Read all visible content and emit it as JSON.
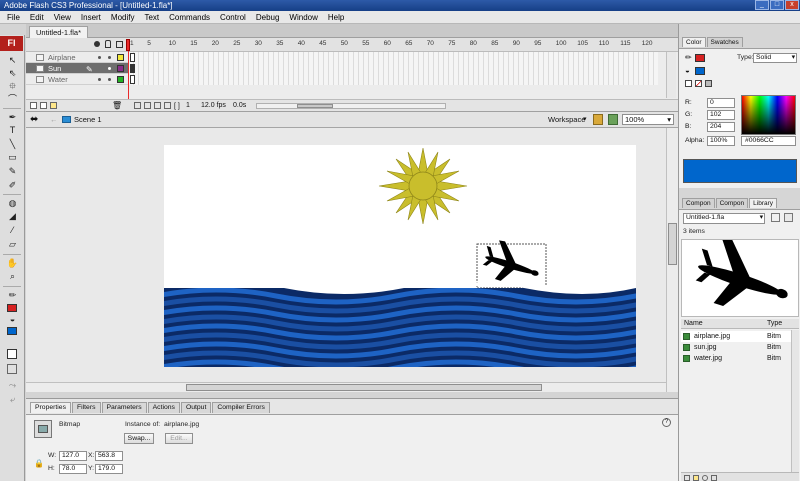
{
  "window": {
    "title": "Adobe Flash CS3 Professional - [Untitled-1.fla*]",
    "controls": [
      "_",
      "□",
      "x"
    ]
  },
  "menubar": [
    "File",
    "Edit",
    "View",
    "Insert",
    "Modify",
    "Text",
    "Commands",
    "Control",
    "Debug",
    "Window",
    "Help"
  ],
  "tools": {
    "logo": "Fl",
    "icons": [
      "selection-tool-icon",
      "subselection-tool-icon",
      "free-transform-tool-icon",
      "lasso-tool-icon",
      "pen-tool-icon",
      "text-tool-icon",
      "line-tool-icon",
      "rectangle-tool-icon",
      "pencil-tool-icon",
      "brush-tool-icon",
      "ink-bottle-icon",
      "paint-bucket-icon",
      "eyedropper-icon",
      "eraser-tool-icon",
      "hand-tool-icon",
      "zoom-tool-icon",
      "stroke-color-icon",
      "fill-color-icon"
    ]
  },
  "document": {
    "tab": "Untitled-1.fla*"
  },
  "timeline": {
    "ticks": [
      "1",
      "5",
      "10",
      "15",
      "20",
      "25",
      "30",
      "35",
      "40",
      "45",
      "50",
      "55",
      "60",
      "65",
      "70",
      "75",
      "80",
      "85",
      "90",
      "95",
      "100",
      "105",
      "110",
      "115",
      "120"
    ],
    "layers": [
      {
        "name": "Airplane",
        "color": "#f2e83a",
        "selected": false
      },
      {
        "name": "Sun",
        "color": "#8b2d8b",
        "selected": true
      },
      {
        "name": "Water",
        "color": "#22b422",
        "selected": false
      }
    ],
    "current_frame": "1",
    "fps": "12.0 fps",
    "time": "0.0s"
  },
  "editbar": {
    "scene": "Scene 1",
    "workspace": "Workspace",
    "zoom": "100%"
  },
  "stage": {
    "background": "#ffffff",
    "sun_color": "#c9be2c",
    "water_colors": [
      "#0b2a66",
      "#1e63c4"
    ],
    "airplane_color": "#000000"
  },
  "properties": {
    "tabs": [
      "Properties",
      "Filters",
      "Parameters",
      "Actions",
      "Output",
      "Compiler Errors"
    ],
    "type": "Bitmap",
    "instance_of_label": "Instance of:",
    "instance_of": "airplane.jpg",
    "swap": "Swap...",
    "edit": "Edit...",
    "w_label": "W:",
    "w": "127.0",
    "x_label": "X:",
    "x": "563.8",
    "h_label": "H:",
    "h": "78.0",
    "y_label": "Y:",
    "y": "179.0"
  },
  "color_panel": {
    "tabs": [
      "Color",
      "Swatches"
    ],
    "type_label": "Type:",
    "type": "Solid",
    "r_label": "R:",
    "r": "0",
    "g_label": "G:",
    "g": "102",
    "b_label": "B:",
    "b": "204",
    "alpha_label": "Alpha:",
    "alpha": "100%",
    "hex": "#0066CC",
    "swatch": "#0066cc"
  },
  "library": {
    "tabs": [
      "Compon",
      "Compon",
      "Library"
    ],
    "document": "Untitled-1.fla",
    "count": "3 items",
    "col_name": "Name",
    "col_type": "Type",
    "items": [
      {
        "name": "airplane.jpg",
        "type": "Bitm"
      },
      {
        "name": "sun.jpg",
        "type": "Bitm"
      },
      {
        "name": "water.jpg",
        "type": "Bitm"
      }
    ]
  }
}
